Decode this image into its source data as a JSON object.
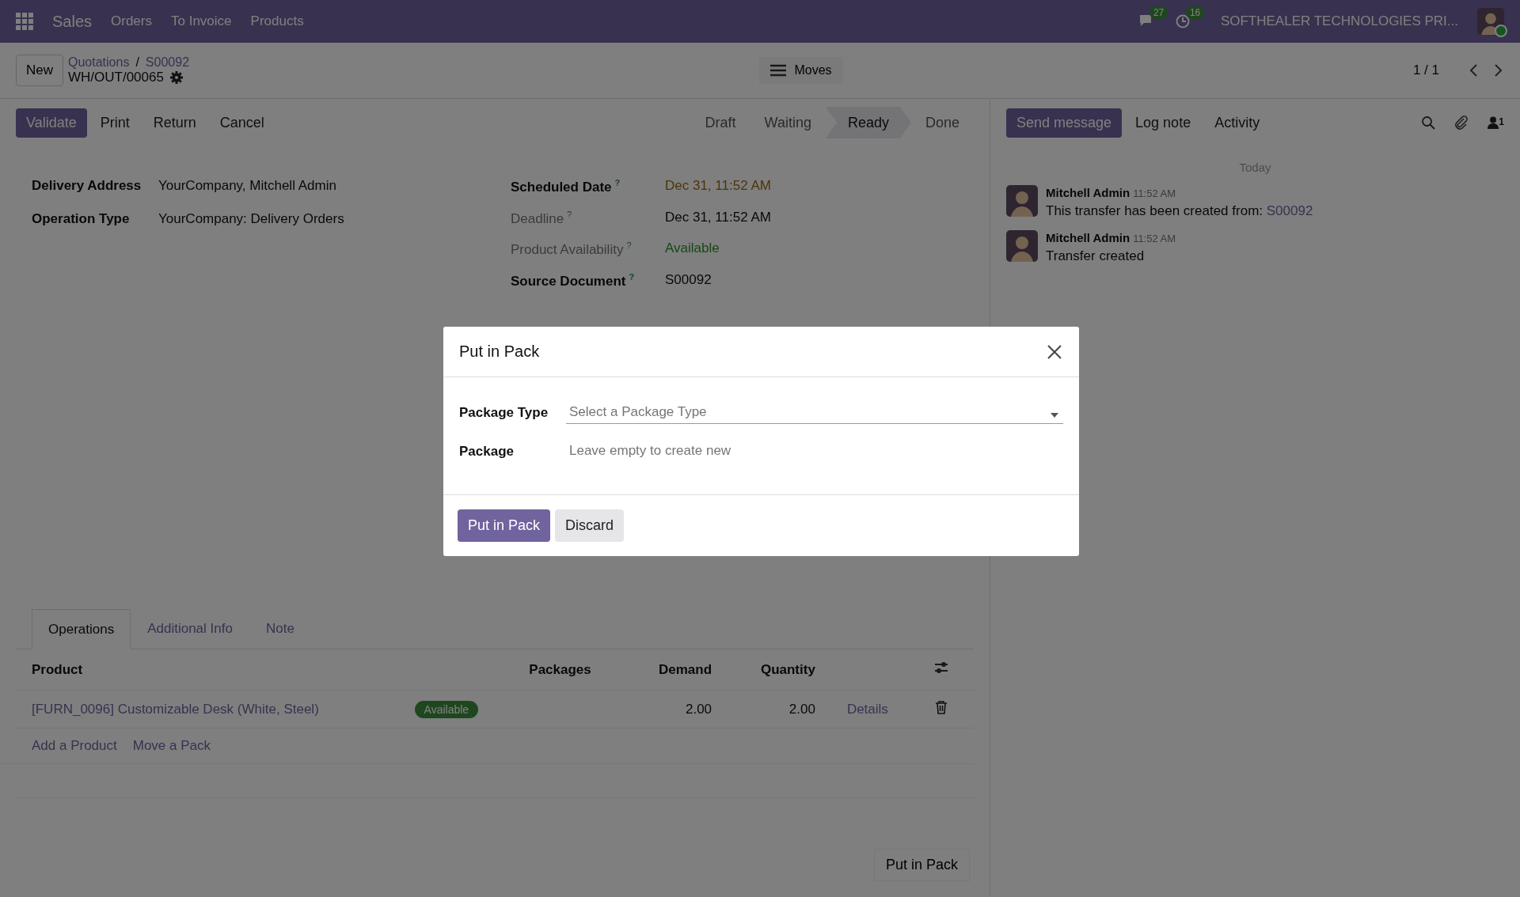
{
  "navbar": {
    "app": "Sales",
    "menu": [
      "Orders",
      "To Invoice",
      "Products"
    ],
    "messages_count": "27",
    "activities_count": "16",
    "company": "SOFTHEALER TECHNOLOGIES PRI..."
  },
  "control_panel": {
    "new_button": "New",
    "breadcrumbs": [
      "Quotations",
      "S00092"
    ],
    "separator": "/",
    "record": "WH/OUT/00065",
    "moves_button": "Moves",
    "pager": "1 / 1"
  },
  "actions": [
    {
      "label": "Validate",
      "primary": true
    },
    {
      "label": "Print",
      "primary": false
    },
    {
      "label": "Return",
      "primary": false
    },
    {
      "label": "Cancel",
      "primary": false
    }
  ],
  "statusbar": [
    {
      "label": "Draft",
      "selected": false
    },
    {
      "label": "Waiting",
      "selected": false
    },
    {
      "label": "Ready",
      "selected": true
    },
    {
      "label": "Done",
      "selected": false
    }
  ],
  "form": {
    "left_fields": [
      {
        "label": "Delivery Address",
        "value": "YourCompany, Mitchell Admin"
      },
      {
        "label": "Operation Type",
        "value": "YourCompany: Delivery Orders"
      }
    ],
    "right_fields": [
      {
        "label": "Scheduled Date",
        "help": "?",
        "emphasis": true,
        "value": "Dec 31, 11:52 AM",
        "kind": "warning"
      },
      {
        "label": "Deadline",
        "help": "?",
        "emphasis": false,
        "value": "Dec 31, 11:52 AM",
        "kind": "plain"
      },
      {
        "label": "Product Availability",
        "help": "?",
        "emphasis": false,
        "value": "Available",
        "kind": "success"
      },
      {
        "label": "Source Document",
        "help": "?",
        "emphasis": true,
        "value": "S00092",
        "kind": "plain"
      }
    ]
  },
  "tabs": [
    {
      "label": "Operations",
      "selected": true
    },
    {
      "label": "Additional Info",
      "selected": false
    },
    {
      "label": "Note",
      "selected": false
    }
  ],
  "table": {
    "columns": [
      "Product",
      "Packages",
      "Demand",
      "Quantity"
    ],
    "rows": [
      {
        "product": "[FURN_0096] Customizable Desk (White, Steel)",
        "badge": "Available",
        "demand": "2.00",
        "quantity": "2.00",
        "details": "Details"
      }
    ],
    "add_links": [
      "Add a Product",
      "Move a Pack"
    ]
  },
  "put_in_pack_button": "Put in Pack",
  "chatter": {
    "buttons": [
      {
        "label": "Send message",
        "primary": true
      },
      {
        "label": "Log note",
        "primary": false
      },
      {
        "label": "Activity",
        "primary": false
      }
    ],
    "followers_count": "1",
    "date_separator": "Today",
    "messages": [
      {
        "author": "Mitchell Admin",
        "time": "11:52 AM",
        "body": "This transfer has been created from: ",
        "link": "S00092"
      },
      {
        "author": "Mitchell Admin",
        "time": "11:52 AM",
        "body": "Transfer created"
      }
    ]
  },
  "dialog": {
    "title": "Put in Pack",
    "fields": [
      {
        "label": "Package Type",
        "placeholder": "Select a Package Type",
        "kind": "select"
      },
      {
        "label": "Package",
        "placeholder": "Leave empty to create new",
        "kind": "text"
      }
    ],
    "buttons": [
      {
        "label": "Put in Pack",
        "primary": true
      },
      {
        "label": "Discard",
        "primary": false
      }
    ]
  }
}
